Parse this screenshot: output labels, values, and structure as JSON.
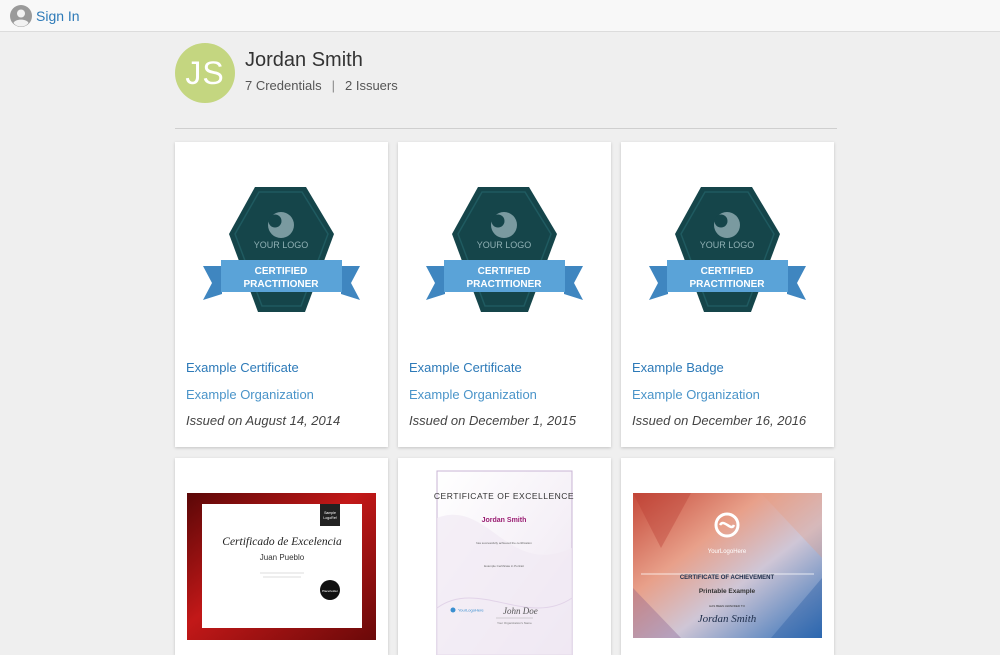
{
  "header": {
    "signin_label": "Sign In"
  },
  "profile": {
    "initials": "JS",
    "name": "Jordan Smith",
    "credentials": "7 Credentials",
    "separator": "|",
    "issuers": "2 Issuers",
    "avatar_color": "#c4d680"
  },
  "badge_art": {
    "logo_text": "YOUR LOGO",
    "line1": "CERTIFIED",
    "line2": "PRACTITIONER",
    "hex_color": "#15454a",
    "ribbon_color": "#5aa3d8"
  },
  "cards": [
    {
      "title": "Example Certificate",
      "org": "Example Organization",
      "date": "Issued on August 14, 2014"
    },
    {
      "title": "Example Certificate",
      "org": "Example Organization",
      "date": "Issued on December 1, 2015"
    },
    {
      "title": "Example Badge",
      "org": "Example Organization",
      "date": "Issued on December 16, 2016"
    }
  ],
  "cert1": {
    "title": "Certificado de Excelencia",
    "name": "Juan Pueblo",
    "tag_line1": "Sample",
    "tag_line2": "LogoRef",
    "seal_text": "Placeholder"
  },
  "cert2": {
    "title": "CERTIFICATE OF EXCELLENCE",
    "name": "Jordan Smith",
    "line1": "has successfully achieved the certification",
    "line2": "Example Certificate in Portrait",
    "logo": "YourLogoHere",
    "signature": "John Doe",
    "signer_title": "Your Organization's Name"
  },
  "cert3": {
    "logo": "YourLogoHere",
    "title": "CERTIFICATE OF ACHIEVEMENT",
    "subtitle": "Printable Example",
    "line": "HAS BEEN AWARDED TO",
    "name": "Jordan Smith"
  },
  "colors": {
    "link": "#2d7ab8",
    "link_light": "#4a94c9",
    "background": "#efefef"
  }
}
